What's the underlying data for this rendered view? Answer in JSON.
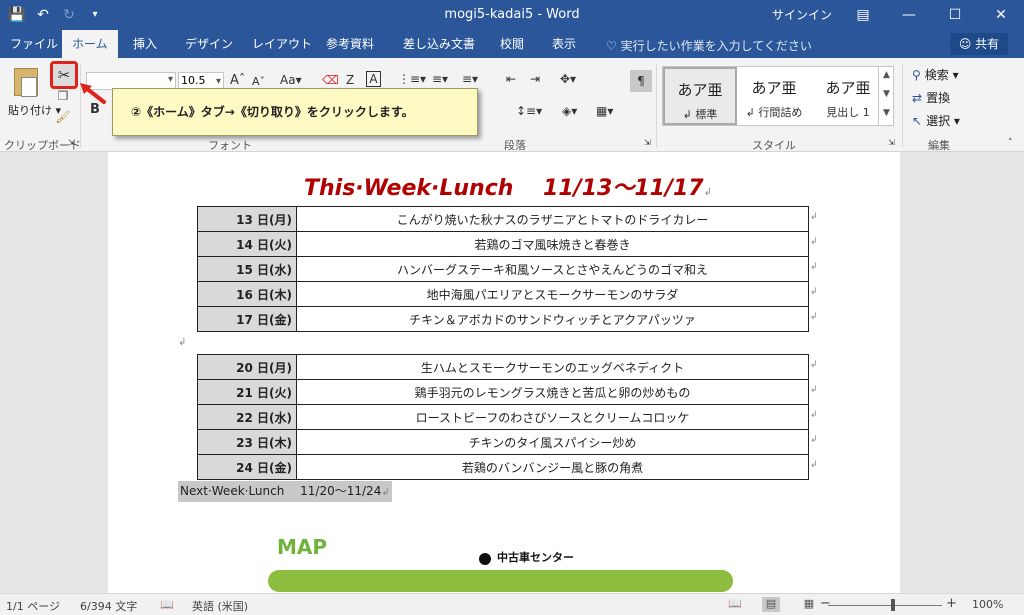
{
  "titlebar": {
    "save_icon": "save-icon",
    "undo_icon": "undo-icon",
    "redo_icon": "redo-icon",
    "qat_menu_icon": "qat-menu-icon",
    "title": "mogi5-kadai5  -  Word",
    "signin": "サインイン",
    "ribbon_display_icon": "ribbon-display-icon",
    "minimize_icon": "minimize-icon",
    "maximize_icon": "maximize-icon",
    "close_icon": "close-icon"
  },
  "tabs": [
    {
      "label": "ファイル"
    },
    {
      "label": "ホーム"
    },
    {
      "label": "挿入"
    },
    {
      "label": "デザイン"
    },
    {
      "label": "レイアウト"
    },
    {
      "label": "参考資料"
    },
    {
      "label": "差し込み文書"
    },
    {
      "label": "校閲"
    },
    {
      "label": "表示"
    }
  ],
  "tell_me": "♡ 実行したい作業を入力してください",
  "share": "共有",
  "ribbon": {
    "paste_label": "貼り付け",
    "clipboard_label": "クリップボード",
    "font_label": "フォント",
    "font_name": "",
    "font_size": "10.5",
    "paragraph_label": "段落",
    "styles_label": "スタイル",
    "editing_label": "編集",
    "styles": [
      {
        "sample": "あア亜",
        "name": "↲ 標準"
      },
      {
        "sample": "あア亜",
        "name": "↲ 行間詰め"
      },
      {
        "sample": "あア亜",
        "name": "見出し 1"
      }
    ],
    "find": "検索",
    "replace": "置換",
    "select": "選択"
  },
  "callout": "②《ホーム》タブ→《切り取り》をクリックします。",
  "document": {
    "title": "This·Week·Lunch　 11/13～11/17",
    "week1": [
      {
        "day": "13 日(月)",
        "menu": "こんがり焼いた秋ナスのラザニアとトマトのドライカレー"
      },
      {
        "day": "14 日(火)",
        "menu": "若鶏のゴマ風味焼きと春巻き"
      },
      {
        "day": "15 日(水)",
        "menu": "ハンバーグステーキ和風ソースとさやえんどうのゴマ和え"
      },
      {
        "day": "16 日(木)",
        "menu": "地中海風パエリアとスモークサーモンのサラダ"
      },
      {
        "day": "17 日(金)",
        "menu": "チキン＆アボカドのサンドウィッチとアクアパッツァ"
      }
    ],
    "week2": [
      {
        "day": "20 日(月)",
        "menu": "生ハムとスモークサーモンのエッグベネディクト"
      },
      {
        "day": "21 日(火)",
        "menu": "鶏手羽元のレモングラス焼きと苦瓜と卵の炒めもの"
      },
      {
        "day": "22 日(水)",
        "menu": "ローストビーフのわさびソースとクリームコロッケ"
      },
      {
        "day": "23 日(木)",
        "menu": "チキンのタイ風スパイシー炒め"
      },
      {
        "day": "24 日(金)",
        "menu": "若鶏のバンバンジー風と豚の角煮"
      }
    ],
    "next_week": "Next·Week·Lunch　 11/20～11/24",
    "map_label": "MAP",
    "shop_label": "中古車センター"
  },
  "statusbar": {
    "page": "1/1 ページ",
    "words": "6/394 文字",
    "language": "英語 (米国)",
    "zoom": "100%"
  }
}
